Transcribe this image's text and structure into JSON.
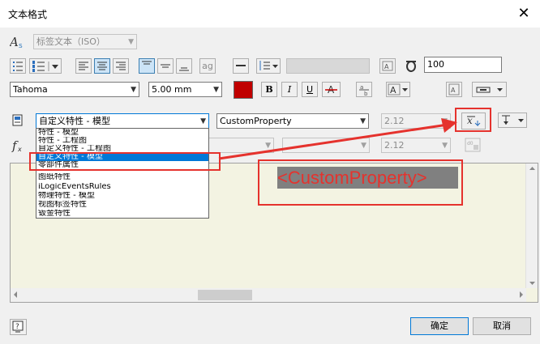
{
  "window": {
    "title": "文本格式",
    "close_glyph": "✕"
  },
  "style_dropdown": {
    "value": "标签文本（ISO）"
  },
  "format_toolbar": {
    "image_button": "ag",
    "text_height_value": "100"
  },
  "font": {
    "name": "Tahoma",
    "size": "5.00 mm",
    "color": "#c00000"
  },
  "font_style": {
    "bold": "B",
    "italic": "I",
    "underline": "U"
  },
  "property_row": {
    "type_value": "自定义特性 - 模型",
    "property_value": "CustomProperty",
    "precision_value": "2.12"
  },
  "parameter_row": {
    "precision_value": "2.12"
  },
  "type_dropdown_options": [
    "特性 - 模型",
    "特性 - 工程图",
    "自定义特性 - 工程图",
    "自定义特性 - 模型",
    "零部件属性",
    "图纸特性",
    "iLogicEventsRules",
    "物理特性 - 模型",
    "视图标签特性",
    "钣金特性"
  ],
  "selected_option_index": 3,
  "editor": {
    "content": "<CustomProperty>"
  },
  "buttons": {
    "ok": "确定",
    "cancel": "取消"
  },
  "colors": {
    "annotation_red": "#e5322d",
    "selection_blue": "#0078d7",
    "editor_bg": "#f3f3e2",
    "highlight_gray": "#808080"
  }
}
